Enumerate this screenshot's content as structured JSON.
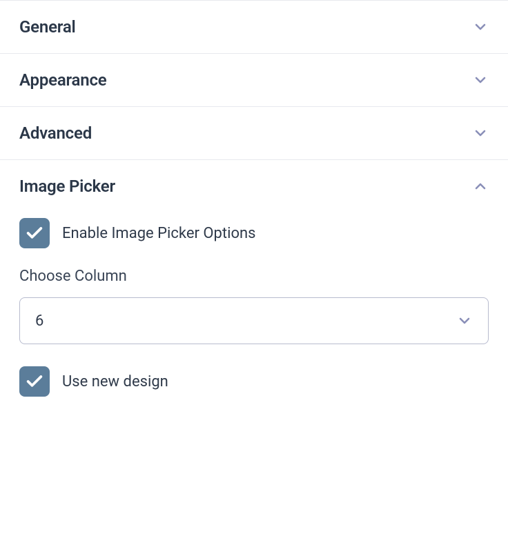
{
  "sections": {
    "general": {
      "title": "General"
    },
    "appearance": {
      "title": "Appearance"
    },
    "advanced": {
      "title": "Advanced"
    },
    "imagePicker": {
      "title": "Image Picker"
    }
  },
  "imagePicker": {
    "enable_label": "Enable Image Picker Options",
    "choose_column_label": "Choose Column",
    "column_value": "6",
    "use_new_design_label": "Use new design"
  }
}
